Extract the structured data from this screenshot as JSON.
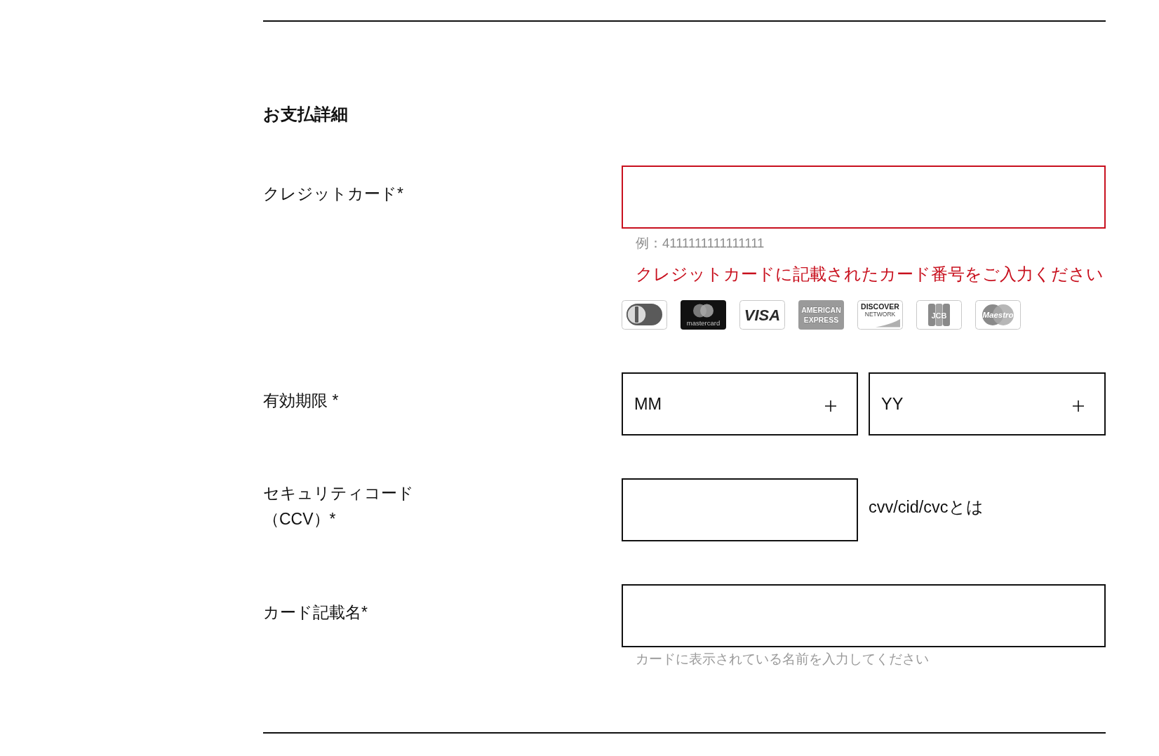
{
  "section": {
    "title": "お支払詳細"
  },
  "fields": [
    {
      "kind": "card_number",
      "label": "クレジットカード*",
      "invalid": true,
      "hint": "例：4111111111111111",
      "error": "クレジットカードに記載されたカード番号をご入力ください",
      "card_logos": [
        {
          "kind": "diners"
        },
        {
          "kind": "mastercard",
          "text": "mastercard"
        },
        {
          "kind": "visa",
          "text": "VISA"
        },
        {
          "kind": "amex",
          "lines": [
            "AMERICAN",
            "EXPRESS"
          ]
        },
        {
          "kind": "discover",
          "text": "DISCOVER",
          "subtext": "NETWORK"
        },
        {
          "kind": "jcb",
          "text": "JCB"
        },
        {
          "kind": "maestro",
          "text": "Maestro"
        }
      ]
    },
    {
      "kind": "expiry",
      "label": "有効期限 *",
      "selects": [
        {
          "value": "MM"
        },
        {
          "value": "YY"
        }
      ]
    },
    {
      "kind": "security_code",
      "label": "セキュリティコード（CCV）*",
      "invalid": false,
      "link": "cvv/cid/cvcとは"
    },
    {
      "kind": "card_name",
      "label": "カード記載名*",
      "invalid": false,
      "hint": "カードに表示されている名前を入力してください"
    }
  ]
}
